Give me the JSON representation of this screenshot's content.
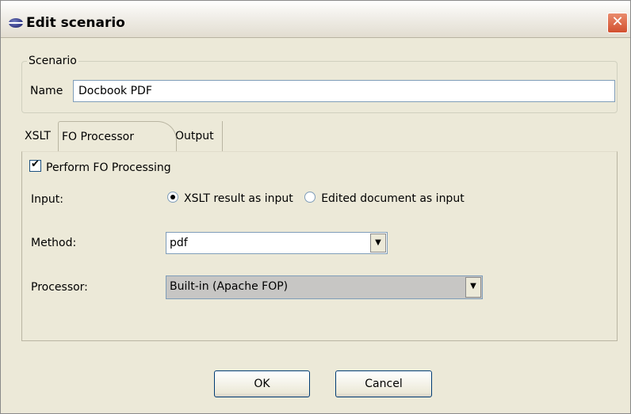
{
  "window": {
    "title": "Edit scenario",
    "close_glyph": "✕"
  },
  "scenario": {
    "legend": "Scenario",
    "name_label": "Name",
    "name_value": "Docbook PDF"
  },
  "tabs": [
    {
      "label": "XSLT"
    },
    {
      "label": "FO Processor",
      "selected": true
    },
    {
      "label": "Output"
    }
  ],
  "fo": {
    "perform_label": "Perform FO Processing",
    "perform_checked": true,
    "check_glyph": "✔",
    "input_label": "Input:",
    "input_options": [
      {
        "label": "XSLT result as input",
        "selected": true
      },
      {
        "label": "Edited document as input",
        "selected": false
      }
    ],
    "method_label": "Method:",
    "method_value": "pdf",
    "processor_label": "Processor:",
    "processor_value": "Built-in (Apache FOP)",
    "arrow_glyph": "▼"
  },
  "buttons": {
    "ok": "OK",
    "cancel": "Cancel"
  }
}
